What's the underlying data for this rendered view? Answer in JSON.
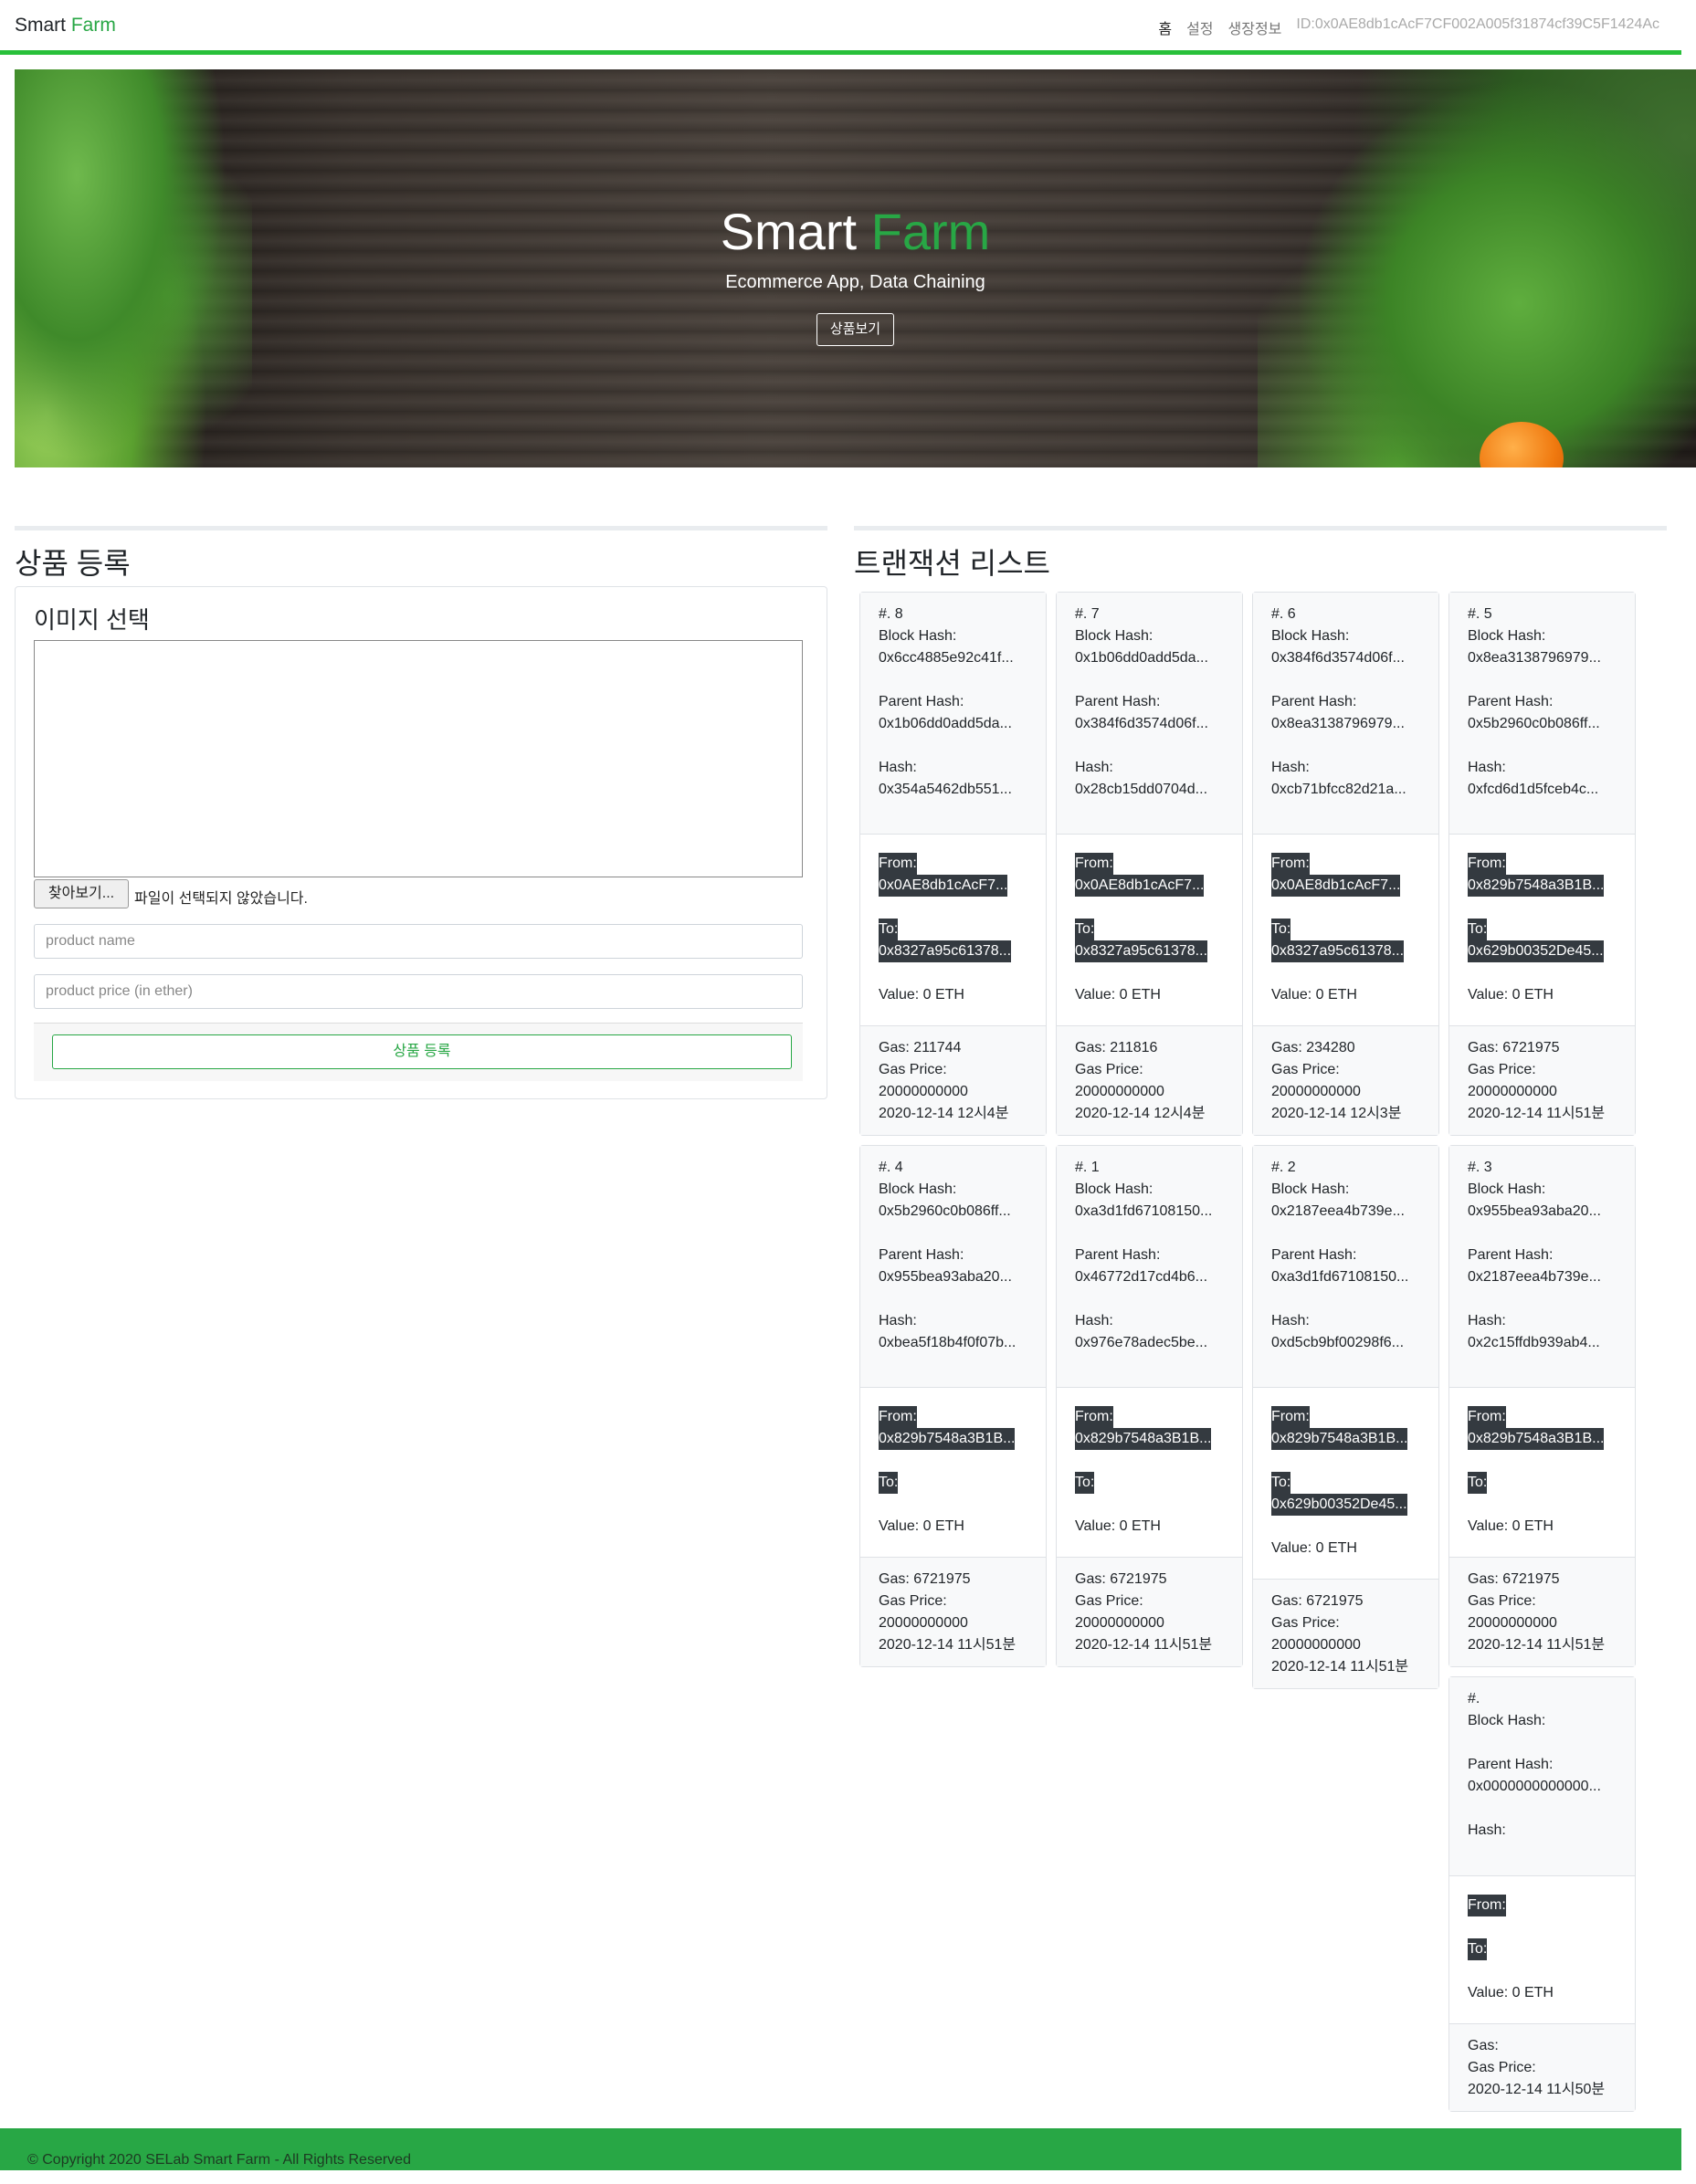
{
  "nav": {
    "brand_1": "Smart",
    "brand_2": "Farm",
    "links": [
      "홈",
      "설정",
      "생장정보"
    ],
    "account": "ID:0x0AE8db1cAcF7CF002A005f31874cf39C5F1424Ac"
  },
  "hero": {
    "title_1": "Smart",
    "title_2": "Farm",
    "subtitle": "Ecommerce App, Data Chaining",
    "button": "상품보기"
  },
  "register": {
    "title": "상품 등록",
    "image_label": "이미지 선택",
    "file_button": "찾아보기...",
    "file_status": "파일이 선택되지 않았습니다.",
    "name_placeholder": "product name",
    "price_placeholder": "product price (in ether)",
    "submit": "상품 등록"
  },
  "tx_list": {
    "title": "트랜잭션 리스트",
    "labels": {
      "block_hash": "Block Hash:",
      "parent_hash": "Parent Hash:",
      "hash": "Hash:",
      "from": "From:",
      "to": "To:",
      "gas_price": "Gas Price:"
    },
    "items": [
      {
        "num": "#. 8",
        "block_hash": "0x6cc4885e92c41f...",
        "parent_hash": "0x1b06dd0add5da...",
        "hash": "0x354a5462db551...",
        "from": "0x0AE8db1cAcF7...",
        "to": "0x8327a95c61378...",
        "value": "Value: 0 ETH",
        "gas": "Gas: 211744",
        "gas_price": "20000000000",
        "time": "2020-12-14 12시4분"
      },
      {
        "num": "#. 7",
        "block_hash": "0x1b06dd0add5da...",
        "parent_hash": "0x384f6d3574d06f...",
        "hash": "0x28cb15dd0704d...",
        "from": "0x0AE8db1cAcF7...",
        "to": "0x8327a95c61378...",
        "value": "Value: 0 ETH",
        "gas": "Gas: 211816",
        "gas_price": "20000000000",
        "time": "2020-12-14 12시4분"
      },
      {
        "num": "#. 6",
        "block_hash": "0x384f6d3574d06f...",
        "parent_hash": "0x8ea3138796979...",
        "hash": "0xcb71bfcc82d21a...",
        "from": "0x0AE8db1cAcF7...",
        "to": "0x8327a95c61378...",
        "value": "Value: 0 ETH",
        "gas": "Gas: 234280",
        "gas_price": "20000000000",
        "time": "2020-12-14 12시3분"
      },
      {
        "num": "#. 5",
        "block_hash": "0x8ea3138796979...",
        "parent_hash": "0x5b2960c0b086ff...",
        "hash": "0xfcd6d1d5fceb4c...",
        "from": "0x829b7548a3B1B...",
        "to": "0x629b00352De45...",
        "value": "Value: 0 ETH",
        "gas": "Gas: 6721975",
        "gas_price": "20000000000",
        "time": "2020-12-14 11시51분"
      },
      {
        "num": "#. 4",
        "block_hash": "0x5b2960c0b086ff...",
        "parent_hash": "0x955bea93aba20...",
        "hash": "0xbea5f18b4f0f07b...",
        "from": "0x829b7548a3B1B...",
        "to": "",
        "value": "Value: 0 ETH",
        "gas": "Gas: 6721975",
        "gas_price": "20000000000",
        "time": "2020-12-14 11시51분"
      },
      {
        "num": "#. 1",
        "block_hash": "0xa3d1fd67108150...",
        "parent_hash": "0x46772d17cd4b6...",
        "hash": "0x976e78adec5be...",
        "from": "0x829b7548a3B1B...",
        "to": "",
        "value": "Value: 0 ETH",
        "gas": "Gas: 6721975",
        "gas_price": "20000000000",
        "time": "2020-12-14 11시51분"
      },
      {
        "num": "#. 2",
        "block_hash": "0x2187eea4b739e...",
        "parent_hash": "0xa3d1fd67108150...",
        "hash": "0xd5cb9bf00298f6...",
        "from": "0x829b7548a3B1B...",
        "to": "0x629b00352De45...",
        "value": "Value: 0 ETH",
        "gas": "Gas: 6721975",
        "gas_price": "20000000000",
        "time": "2020-12-14 11시51분"
      },
      {
        "num": "#. 3",
        "block_hash": "0x955bea93aba20...",
        "parent_hash": "0x2187eea4b739e...",
        "hash": "0x2c15ffdb939ab4...",
        "from": "0x829b7548a3B1B...",
        "to": "",
        "value": "Value: 0 ETH",
        "gas": "Gas: 6721975",
        "gas_price": "20000000000",
        "time": "2020-12-14 11시51분"
      },
      {
        "num": "#.",
        "block_hash": "",
        "parent_hash": "0x0000000000000...",
        "hash": "",
        "from": "",
        "to": "",
        "value": "Value: 0 ETH",
        "gas": "Gas:",
        "gas_price": "",
        "time": "2020-12-14 11시50분"
      }
    ]
  },
  "footer": {
    "text": "© Copyright 2020 SELab Smart Farm - All Rights Reserved"
  }
}
